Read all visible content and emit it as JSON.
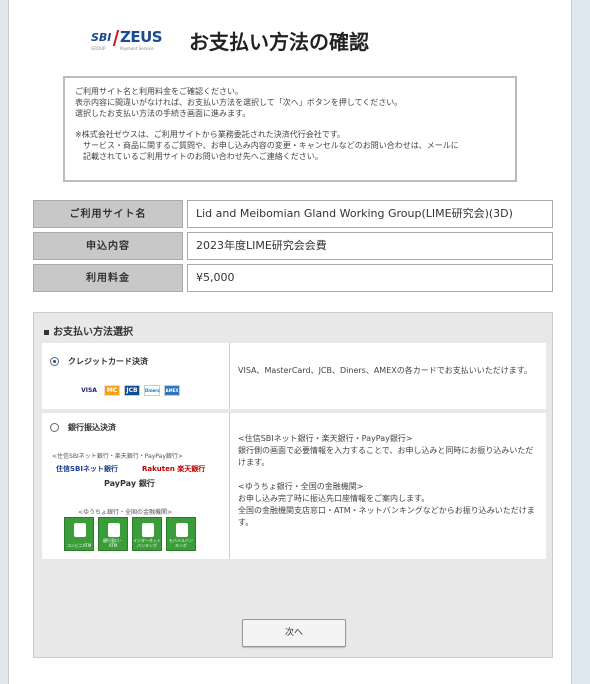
{
  "header": {
    "logo_sbi": "SBI",
    "logo_zeus": "ZEUS",
    "logo_sub1": "GROUP",
    "logo_sub2": "Payment Service",
    "title": "お支払い方法の確認"
  },
  "notice": {
    "line1": "ご利用サイト名と利用料金をご確認ください。",
    "line2": "表示内容に間違いがなければ、お支払い方法を選択して「次へ」ボタンを押してください。",
    "line3": "選択したお支払い方法の手続き画面に進みます。",
    "line4": "※株式会社ゼウスは、ご利用サイトから業務委託された決済代行会社です。",
    "line5": "サービス・商品に関するご質問や、お申し込み内容の変更・キャンセルなどのお問い合わせは、メールに",
    "line6": "記載されているご利用サイトのお問い合わせ先へご連絡ください。"
  },
  "info": {
    "site_label": "ご利用サイト名",
    "site_value": "Lid and Meibomian Gland Working Group(LIME研究会)(3D)",
    "content_label": "申込内容",
    "content_value": "2023年度LIME研究会会費",
    "fee_label": "利用料金",
    "fee_value": "¥5,000"
  },
  "methods": {
    "heading": "お支払い方法選択",
    "credit": {
      "label": "クレジットカード決済",
      "selected": true,
      "description": "VISA、MasterCard、JCB、Diners、AMEXの各カードでお支払いいただけます。",
      "cards": [
        "VISA",
        "MC",
        "JCB",
        "Diners",
        "AMEX"
      ]
    },
    "bank": {
      "label": "銀行振込決済",
      "selected": false,
      "group1_caption": "<住信SBIネット銀行・楽天銀行・PayPay銀行>",
      "bank_sbi": "住信SBIネット銀行",
      "bank_rakuten": "Rakuten 楽天銀行",
      "bank_paypay": "PayPay 銀行",
      "group2_caption": "<ゆうちょ銀行・全国の金融機関>",
      "icons": [
        "コンビニATM",
        "銀行窓口・ATM",
        "インターネットバンキング",
        "モバイルバンキング"
      ],
      "desc1": "<住信SBIネット銀行・楽天銀行・PayPay銀行>",
      "desc2": "銀行側の画面で必要情報を入力することで、お申し込みと同時にお振り込みいただけます。",
      "desc3": "<ゆうちょ銀行・全国の金融機関>",
      "desc4": "お申し込み完了時に振込先口座情報をご案内します。",
      "desc5": "全国の金融機関支店窓口・ATM・ネットバンキングなどからお振り込みいただけます。"
    }
  },
  "next_button": "次へ"
}
